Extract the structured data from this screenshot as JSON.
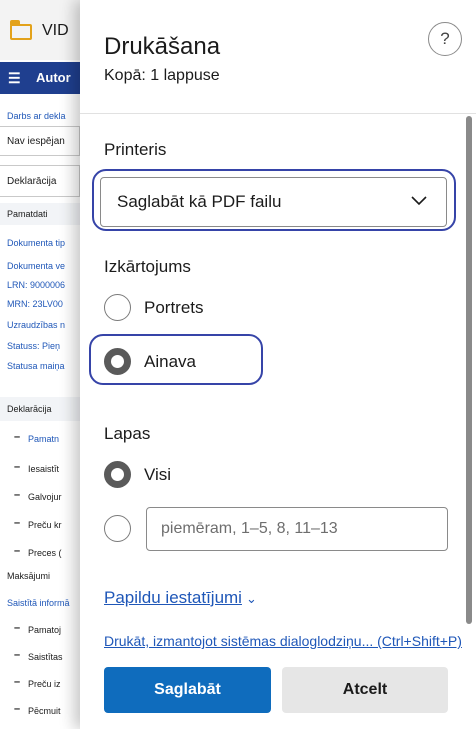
{
  "background": {
    "window_title": "VID",
    "nav_label": "Autor",
    "items": [
      {
        "text": "Darbs ar dekla",
        "link": true
      },
      {
        "text": "Nav iespējan",
        "link": false
      },
      {
        "text": "Deklarācija",
        "link": false
      },
      {
        "text": "Pamatdati",
        "link": false
      },
      {
        "text": "Dokumenta tip",
        "link": true
      },
      {
        "text": "Dokumenta ve",
        "link": true
      },
      {
        "text": "LRN: 9000006",
        "link": true
      },
      {
        "text": "MRN: 23LV00",
        "link": true
      },
      {
        "text": "Uzraudzības n",
        "link": true
      },
      {
        "text": "Statuss: Pieņ",
        "link": true
      },
      {
        "text": "Statusa maiņa",
        "link": true
      },
      {
        "text": "Deklarācija",
        "link": false
      },
      {
        "text": "Pamatn",
        "link": true
      },
      {
        "text": "Iesaistīt",
        "link": false
      },
      {
        "text": "Galvojur",
        "link": false
      },
      {
        "text": "Preču kr",
        "link": false
      },
      {
        "text": "Preces (",
        "link": false
      },
      {
        "text": "Maksājumi",
        "link": false
      },
      {
        "text": "Saistītā informā",
        "link": true
      },
      {
        "text": "Pamatoj",
        "link": false
      },
      {
        "text": "Saistītas",
        "link": false
      },
      {
        "text": "Preču iz",
        "link": false
      },
      {
        "text": "Pēcmuit",
        "link": false
      }
    ]
  },
  "dialog": {
    "title": "Drukāšana",
    "subtitle": "Kopā: 1 lappuse",
    "help_symbol": "?",
    "printer": {
      "label": "Printeris",
      "selected": "Saglabāt kā PDF failu"
    },
    "layout": {
      "label": "Izkārtojums",
      "options": [
        {
          "label": "Portrets",
          "checked": false
        },
        {
          "label": "Ainava",
          "checked": true
        }
      ]
    },
    "pages": {
      "label": "Lapas",
      "option_all": "Visi",
      "all_checked": true,
      "custom_placeholder": "piemēram, 1–5, 8, 11–13"
    },
    "more_settings": "Papildu iestatījumi",
    "system_dialog_link": "Drukāt, izmantojot sistēmas dialoglodziņu... (Ctrl+Shift+P)",
    "buttons": {
      "save": "Saglabāt",
      "cancel": "Atcelt"
    }
  },
  "colors": {
    "primary": "#0f6cbd",
    "link": "#1f57b8",
    "focus_ring": "#3644a8",
    "nav_bar": "#1f3f8f"
  },
  "icons": {
    "window_icon": "folder-icon",
    "menu": "hamburger-icon",
    "select_arrow": "chevron-down-icon",
    "more_settings_arrow": "chevron-down-icon"
  }
}
